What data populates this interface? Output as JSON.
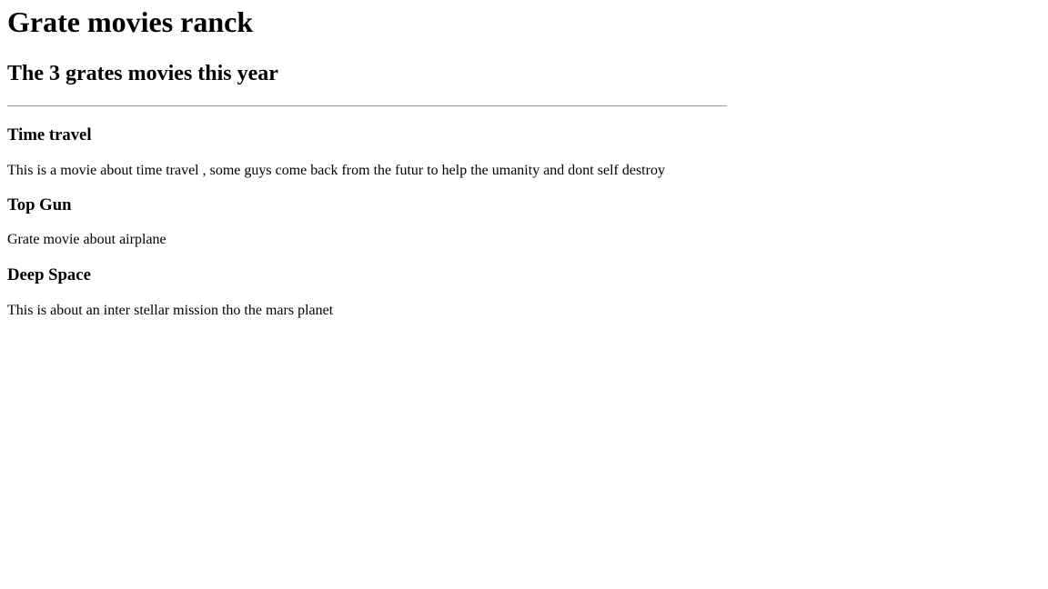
{
  "page": {
    "title": "Grate movies ranck",
    "subtitle": "The 3 grates movies this year"
  },
  "movies": [
    {
      "title": "Time travel",
      "description": "This is a movie about time travel , some guys come back from the futur to help the umanity and dont self destroy"
    },
    {
      "title": "Top Gun",
      "description": "Grate movie about airplane"
    },
    {
      "title": "Deep Space",
      "description": "This is about an inter stellar mission tho the mars planet"
    }
  ]
}
